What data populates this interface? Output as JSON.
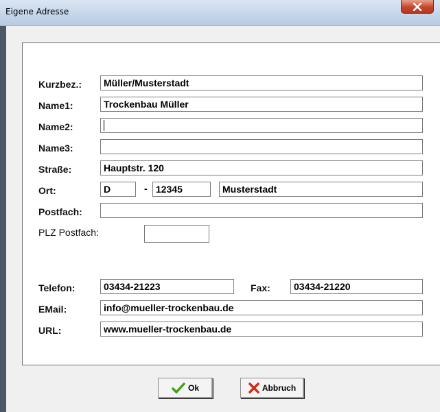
{
  "window": {
    "title": "Eigene Adresse"
  },
  "labels": {
    "kurzbez": "Kurzbez.:",
    "name1": "Name1:",
    "name2": "Name2:",
    "name3": "Name3:",
    "strasse": "Straße:",
    "ort": "Ort:",
    "postfach": "Postfach:",
    "plz_postfach": "PLZ Postfach:",
    "telefon": "Telefon:",
    "fax": "Fax:",
    "email": "EMail:",
    "url": "URL:"
  },
  "fields": {
    "kurzbez": "Müller/Musterstadt",
    "name1": "Trockenbau Müller",
    "name2": "",
    "name3": "",
    "strasse": "Hauptstr. 120",
    "land": "D",
    "plz": "12345",
    "ort": "Musterstadt",
    "postfach": "",
    "plz_postfach": "",
    "telefon": "03434-21223",
    "fax": "03434-21220",
    "email": "info@mueller-trockenbau.de",
    "url": "www.mueller-trockenbau.de"
  },
  "separators": {
    "dash": "-"
  },
  "buttons": {
    "ok": "Ok",
    "cancel": "Abbruch"
  },
  "icons": {
    "close": "close-icon",
    "ok": "checkmark-icon",
    "cancel": "x-cross-icon"
  },
  "colors": {
    "check": "#3fa21a",
    "cross": "#d42a1a",
    "close_button": "#c7462a"
  }
}
